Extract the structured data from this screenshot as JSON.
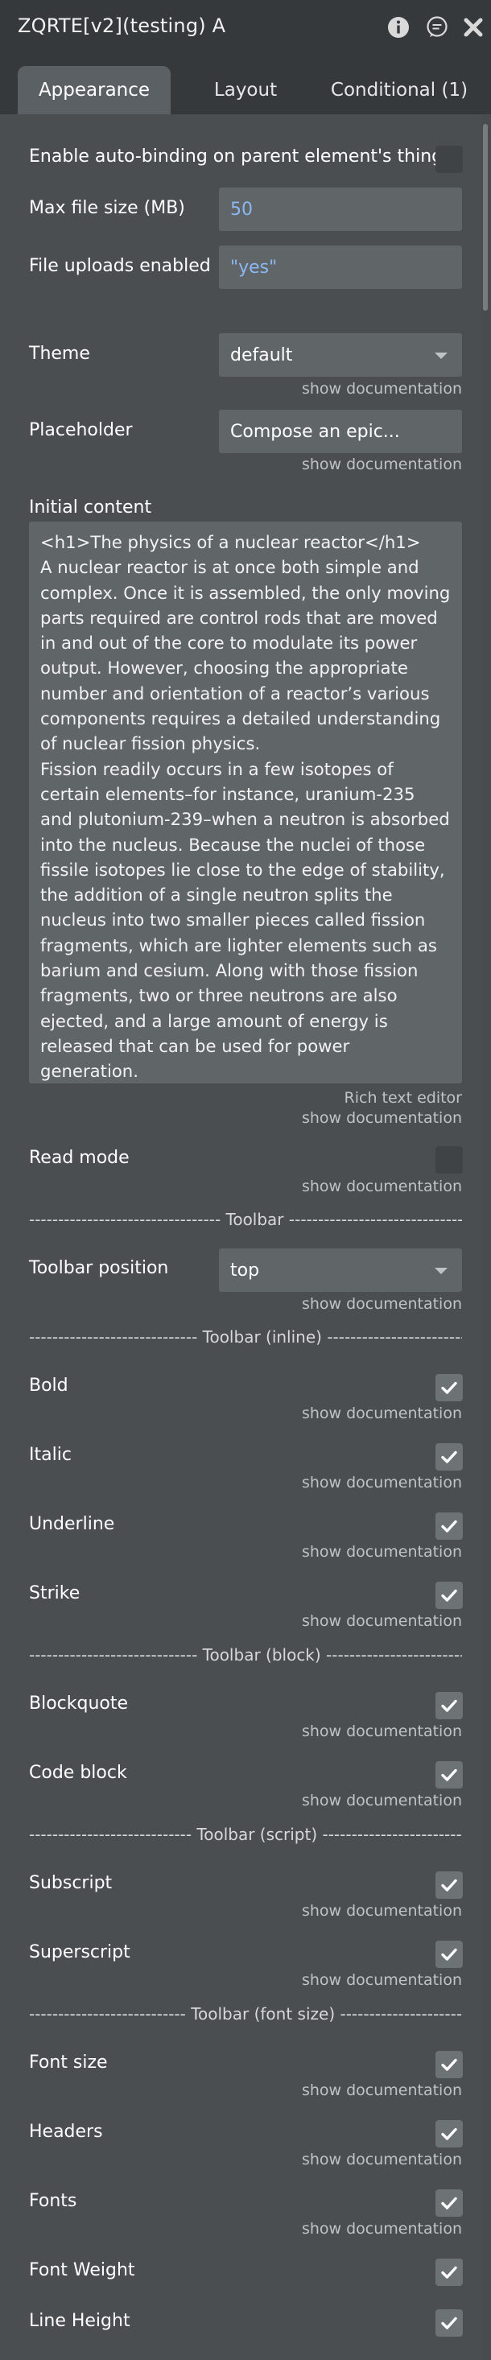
{
  "window": {
    "title": "ZQRTE[v2](testing) A"
  },
  "tabs": [
    {
      "label": "Appearance"
    },
    {
      "label": "Layout"
    },
    {
      "label": "Conditional (1)"
    }
  ],
  "fields": {
    "auto_binding": {
      "label": "Enable auto-binding on parent element's thing",
      "checked": false
    },
    "max_file_size": {
      "label": "Max file size (MB)",
      "value": "50"
    },
    "file_uploads": {
      "label": "File uploads enabled",
      "value": "\"yes\""
    },
    "theme": {
      "label": "Theme",
      "value": "default",
      "doc": "show documentation"
    },
    "placeholder": {
      "label": "Placeholder",
      "value": "Compose an epic...",
      "doc": "show documentation"
    },
    "initial_content": {
      "label": "Initial content",
      "value": "<h1>The physics of a nuclear reactor</h1>\nA nuclear reactor is at once both simple and complex. Once it is assembled, the only moving parts required are control rods that are moved in and out of the core to modulate its power output. However, choosing the appropriate number and orientation of a reactor’s various components requires a detailed understanding of nuclear fission physics.\nFission readily occurs in a few isotopes of certain elements–for instance, uranium-235 and plutonium-239–when a neutron is absorbed into the nucleus. Because the nuclei of those fissile isotopes lie close to the edge of stability, the addition of a single neutron splits the nucleus into two smaller pieces called fission fragments, which are lighter elements such as barium and cesium. Along with those fission fragments, two or three neutrons are also ejected, and a large amount of energy is released that can be used for power generation.",
      "editor_note": "Rich text editor",
      "doc": "show documentation"
    },
    "read_mode": {
      "label": "Read mode",
      "checked": false,
      "doc": "show documentation"
    },
    "toolbar_position": {
      "label": "Toolbar position",
      "value": "top",
      "doc": "show documentation"
    },
    "bold": {
      "label": "Bold",
      "checked": true,
      "doc": "show documentation"
    },
    "italic": {
      "label": "Italic",
      "checked": true,
      "doc": "show documentation"
    },
    "underline": {
      "label": "Underline",
      "checked": true,
      "doc": "show documentation"
    },
    "strike": {
      "label": "Strike",
      "checked": true,
      "doc": "show documentation"
    },
    "blockquote": {
      "label": "Blockquote",
      "checked": true,
      "doc": "show documentation"
    },
    "code_block": {
      "label": "Code block",
      "checked": true,
      "doc": "show documentation"
    },
    "subscript": {
      "label": "Subscript",
      "checked": true,
      "doc": "show documentation"
    },
    "superscript": {
      "label": "Superscript",
      "checked": true,
      "doc": "show documentation"
    },
    "font_size": {
      "label": "Font size",
      "checked": true,
      "doc": "show documentation"
    },
    "headers": {
      "label": "Headers",
      "checked": true,
      "doc": "show documentation"
    },
    "fonts": {
      "label": "Fonts",
      "checked": true,
      "doc": "show documentation"
    },
    "font_weight": {
      "label": "Font Weight",
      "checked": true
    },
    "line_height": {
      "label": "Line Height",
      "checked": true
    }
  },
  "sections": {
    "toolbar": "--------------------------------- Toolbar ---------------------------------",
    "toolbar_inline": "----------------------------- Toolbar (inline) -----------------------------",
    "toolbar_block": "----------------------------- Toolbar (block) -----------------------------",
    "toolbar_script": "---------------------------- Toolbar (script) ----------------------------",
    "toolbar_font_size": "--------------------------- Toolbar (font size) ---------------------------"
  },
  "icons": {
    "info": "info-icon",
    "comment": "comment-icon",
    "close": "close-icon",
    "dropdown": "chevron-down-icon",
    "check": "checkmark-icon"
  },
  "colors": {
    "panel_bg": "#4a4e51",
    "header_bg": "#35393c",
    "field_bg": "#606568",
    "value_blue": "#8cb8f2"
  }
}
